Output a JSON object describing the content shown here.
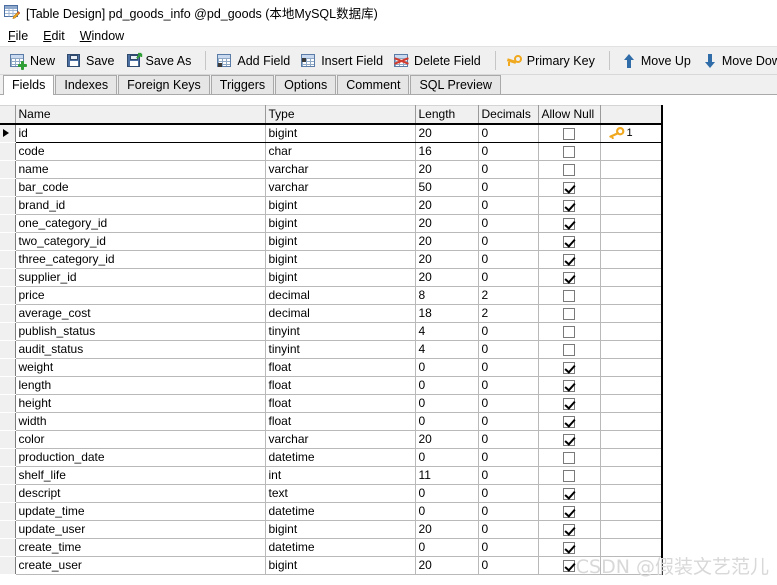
{
  "window": {
    "icon": "table-design-icon",
    "title": "[Table Design] pd_goods_info @pd_goods (本地MySQL数据库)"
  },
  "menubar": {
    "items": [
      {
        "label": "File",
        "accel": "F"
      },
      {
        "label": "Edit",
        "accel": "E"
      },
      {
        "label": "Window",
        "accel": "W"
      }
    ]
  },
  "toolbar": {
    "buttons": [
      {
        "label": "New",
        "icon": "new-table-icon"
      },
      {
        "label": "Save",
        "icon": "save-floppy-icon"
      },
      {
        "label": "Save As",
        "icon": "save-as-icon"
      },
      {
        "label": "Add Field",
        "icon": "add-field-icon"
      },
      {
        "label": "Insert Field",
        "icon": "insert-field-icon"
      },
      {
        "label": "Delete Field",
        "icon": "delete-field-icon"
      },
      {
        "label": "Primary Key",
        "icon": "key-icon"
      },
      {
        "label": "Move Up",
        "icon": "arrow-up-icon"
      },
      {
        "label": "Move Down",
        "icon": "arrow-down-icon"
      }
    ]
  },
  "tabs": {
    "active": "Fields",
    "items": [
      "Fields",
      "Indexes",
      "Foreign Keys",
      "Triggers",
      "Options",
      "Comment",
      "SQL Preview"
    ]
  },
  "grid": {
    "columns": [
      "Name",
      "Type",
      "Length",
      "Decimals",
      "Allow Null",
      ""
    ],
    "current_row_index": 0,
    "rows": [
      {
        "name": "id",
        "type": "bigint",
        "length": "20",
        "decimals": "0",
        "allow_null": false,
        "key": "1"
      },
      {
        "name": "code",
        "type": "char",
        "length": "16",
        "decimals": "0",
        "allow_null": false,
        "key": ""
      },
      {
        "name": "name",
        "type": "varchar",
        "length": "20",
        "decimals": "0",
        "allow_null": false,
        "key": ""
      },
      {
        "name": "bar_code",
        "type": "varchar",
        "length": "50",
        "decimals": "0",
        "allow_null": true,
        "key": ""
      },
      {
        "name": "brand_id",
        "type": "bigint",
        "length": "20",
        "decimals": "0",
        "allow_null": true,
        "key": ""
      },
      {
        "name": "one_category_id",
        "type": "bigint",
        "length": "20",
        "decimals": "0",
        "allow_null": true,
        "key": ""
      },
      {
        "name": "two_category_id",
        "type": "bigint",
        "length": "20",
        "decimals": "0",
        "allow_null": true,
        "key": ""
      },
      {
        "name": "three_category_id",
        "type": "bigint",
        "length": "20",
        "decimals": "0",
        "allow_null": true,
        "key": ""
      },
      {
        "name": "supplier_id",
        "type": "bigint",
        "length": "20",
        "decimals": "0",
        "allow_null": true,
        "key": ""
      },
      {
        "name": "price",
        "type": "decimal",
        "length": "8",
        "decimals": "2",
        "allow_null": false,
        "key": ""
      },
      {
        "name": "average_cost",
        "type": "decimal",
        "length": "18",
        "decimals": "2",
        "allow_null": false,
        "key": ""
      },
      {
        "name": "publish_status",
        "type": "tinyint",
        "length": "4",
        "decimals": "0",
        "allow_null": false,
        "key": ""
      },
      {
        "name": "audit_status",
        "type": "tinyint",
        "length": "4",
        "decimals": "0",
        "allow_null": false,
        "key": ""
      },
      {
        "name": "weight",
        "type": "float",
        "length": "0",
        "decimals": "0",
        "allow_null": true,
        "key": ""
      },
      {
        "name": "length",
        "type": "float",
        "length": "0",
        "decimals": "0",
        "allow_null": true,
        "key": ""
      },
      {
        "name": "height",
        "type": "float",
        "length": "0",
        "decimals": "0",
        "allow_null": true,
        "key": ""
      },
      {
        "name": "width",
        "type": "float",
        "length": "0",
        "decimals": "0",
        "allow_null": true,
        "key": ""
      },
      {
        "name": "color",
        "type": "varchar",
        "length": "20",
        "decimals": "0",
        "allow_null": true,
        "key": ""
      },
      {
        "name": "production_date",
        "type": "datetime",
        "length": "0",
        "decimals": "0",
        "allow_null": false,
        "key": ""
      },
      {
        "name": "shelf_life",
        "type": "int",
        "length": "11",
        "decimals": "0",
        "allow_null": false,
        "key": ""
      },
      {
        "name": "descript",
        "type": "text",
        "length": "0",
        "decimals": "0",
        "allow_null": true,
        "key": ""
      },
      {
        "name": "update_time",
        "type": "datetime",
        "length": "0",
        "decimals": "0",
        "allow_null": true,
        "key": ""
      },
      {
        "name": "update_user",
        "type": "bigint",
        "length": "20",
        "decimals": "0",
        "allow_null": true,
        "key": ""
      },
      {
        "name": "create_time",
        "type": "datetime",
        "length": "0",
        "decimals": "0",
        "allow_null": true,
        "key": ""
      },
      {
        "name": "create_user",
        "type": "bigint",
        "length": "20",
        "decimals": "0",
        "allow_null": true,
        "key": ""
      }
    ]
  },
  "watermark": {
    "text": "CSDN @假装文艺范儿"
  },
  "colors": {
    "key_gold": "#f0a81e",
    "toolbar_bg": "#f0f0f0",
    "grid_line": "#b9b9b9",
    "accent_blue": "#2f6ca8"
  }
}
